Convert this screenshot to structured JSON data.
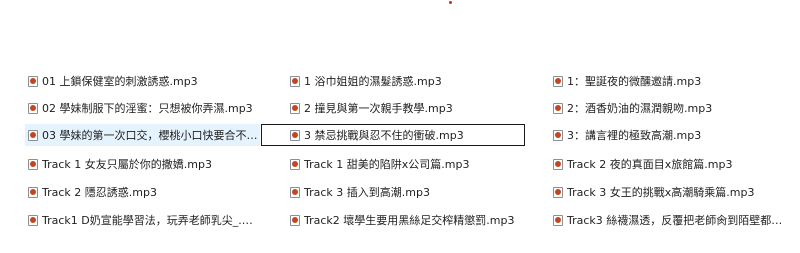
{
  "files": {
    "col1": [
      {
        "name": "01 上鎖保健室的刺激誘惑.mp3"
      },
      {
        "name": "02 學妹制服下的淫蜜：只想被你弄濕.mp3"
      },
      {
        "name": "03 學妹的第一次口交，櫻桃小口快要合不下…"
      },
      {
        "name": "Track 1 女友只屬於你的撒嬌.mp3"
      },
      {
        "name": "Track 2 隱忍誘惑.mp3"
      },
      {
        "name": "Track1 D奶宣能學習法，玩弄老師乳尖_.mp3"
      }
    ],
    "col2": [
      {
        "name": "1 浴巾姐姐的濕髮誘惑.mp3"
      },
      {
        "name": "2 撞見與第一次親手教學.mp3"
      },
      {
        "name": "3 禁忌挑戰與忍不住的衝破.mp3"
      },
      {
        "name": "Track 1 甜美的陷阱x公司篇.mp3"
      },
      {
        "name": "Track 3 插入到高潮.mp3"
      },
      {
        "name": "Track2 壞學生要用黑絲足交榨精懲罰.mp3"
      }
    ],
    "col3": [
      {
        "name": "1：聖誕夜的微醺邀請.mp3"
      },
      {
        "name": "2：酒香奶油的濕潤親吻.mp3"
      },
      {
        "name": "3：講言裡的極致高潮.mp3"
      },
      {
        "name": "Track 2 夜的真面目x旅館篇.mp3"
      },
      {
        "name": "Track 3 女王的挑戰x高潮騎乘篇.mp3"
      },
      {
        "name": "Track3 絲襪濕透，反覆把老師肏到陌壁都聽…"
      }
    ]
  },
  "icon": "audio-file-icon",
  "colors": {
    "hover_bg": "#e5f3ff",
    "focus_border": "#1a1a1a",
    "icon_accent": "#c2461f",
    "marker": "#e02020"
  }
}
